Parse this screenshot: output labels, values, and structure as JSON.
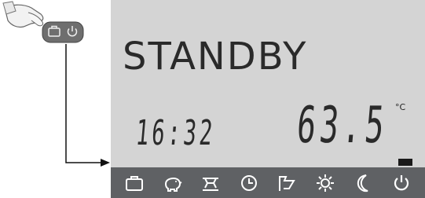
{
  "display": {
    "mode_text": "STANDBY",
    "time": "16:32",
    "temperature": "63.5",
    "temperature_unit": "°C"
  },
  "colors": {
    "lcd_background": "#d4d4d4",
    "icon_bar": "#5f6164",
    "segment": "#2a2a2a"
  },
  "icon_bar": [
    {
      "name": "briefcase-icon"
    },
    {
      "name": "piggy-bank-icon"
    },
    {
      "name": "legionella-icon"
    },
    {
      "name": "clock-icon"
    },
    {
      "name": "boost-icon"
    },
    {
      "name": "sun-icon"
    },
    {
      "name": "moon-icon"
    },
    {
      "name": "power-icon"
    }
  ],
  "button_icons": [
    "briefcase-icon",
    "power-icon"
  ]
}
